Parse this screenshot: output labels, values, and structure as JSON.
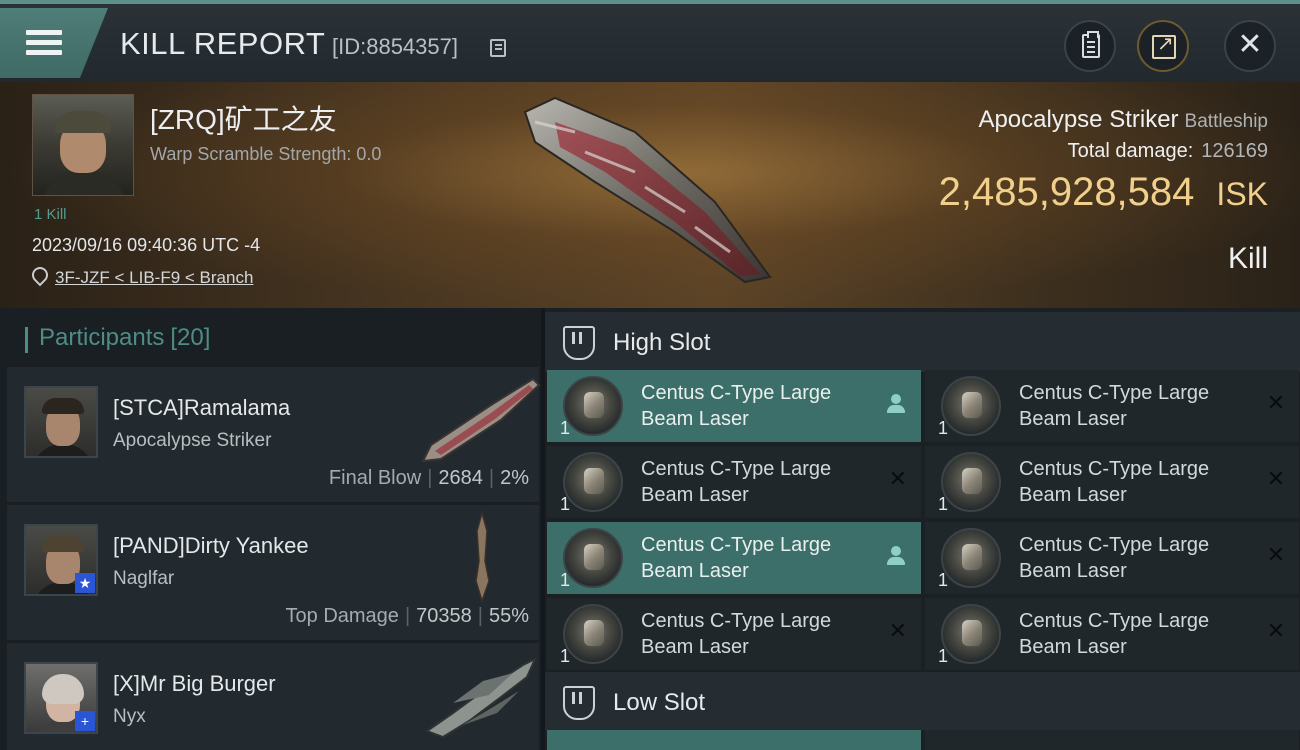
{
  "header": {
    "title": "KILL REPORT",
    "report_id": "[ID:8854357]"
  },
  "victim": {
    "name": "[ZRQ]矿工之友",
    "warp_scramble": "Warp Scramble Strength: 0.0",
    "kills": "1 Kill",
    "timestamp": "2023/09/16 09:40:36 UTC -4",
    "location": "3F-JZF < LIB-F9 < Branch",
    "ship": "Apocalypse Striker",
    "ship_class": "Battleship",
    "total_damage_label": "Total damage:",
    "total_damage": "126169",
    "isk_value": "2,485,928,584",
    "isk_unit": "ISK",
    "result": "Kill"
  },
  "participants": {
    "label": "Participants",
    "count": "[20]",
    "items": [
      {
        "name": "[STCA]Ramalama",
        "ship": "Apocalypse Striker",
        "role": "Final Blow",
        "damage": "2684",
        "percent": "2%",
        "badge": ""
      },
      {
        "name": "[PAND]Dirty Yankee",
        "ship": "Naglfar",
        "role": "Top Damage",
        "damage": "70358",
        "percent": "55%",
        "badge": "★"
      },
      {
        "name": "[X]Mr Big Burger",
        "ship": "Nyx",
        "role": "",
        "damage": "",
        "percent": "",
        "badge": "+"
      }
    ]
  },
  "slots": {
    "high_label": "High Slot",
    "low_label": "Low Slot",
    "high_modules": [
      {
        "name": "Centus C-Type Large Beam Laser",
        "qty": "1",
        "state": "dropped"
      },
      {
        "name": "Centus C-Type Large Beam Laser",
        "qty": "1",
        "state": "destroyed"
      },
      {
        "name": "Centus C-Type Large Beam Laser",
        "qty": "1",
        "state": "destroyed"
      },
      {
        "name": "Centus C-Type Large Beam Laser",
        "qty": "1",
        "state": "destroyed"
      },
      {
        "name": "Centus C-Type Large Beam Laser",
        "qty": "1",
        "state": "dropped"
      },
      {
        "name": "Centus C-Type Large Beam Laser",
        "qty": "1",
        "state": "destroyed"
      },
      {
        "name": "Centus C-Type Large Beam Laser",
        "qty": "1",
        "state": "destroyed"
      },
      {
        "name": "Centus C-Type Large Beam Laser",
        "qty": "1",
        "state": "destroyed"
      }
    ]
  },
  "colors": {
    "accent": "#4e8d86",
    "isk": "#f1d08c",
    "dropped_row": "#3c6f69"
  },
  "icons": {
    "menu": "hamburger-icon",
    "copy": "copy-icon",
    "clipboard": "clipboard-icon",
    "share": "share-icon",
    "close": "close-icon",
    "location": "location-pin-icon",
    "slot": "high-slot-icon",
    "dropped": "person-icon",
    "destroyed": "x-icon"
  }
}
